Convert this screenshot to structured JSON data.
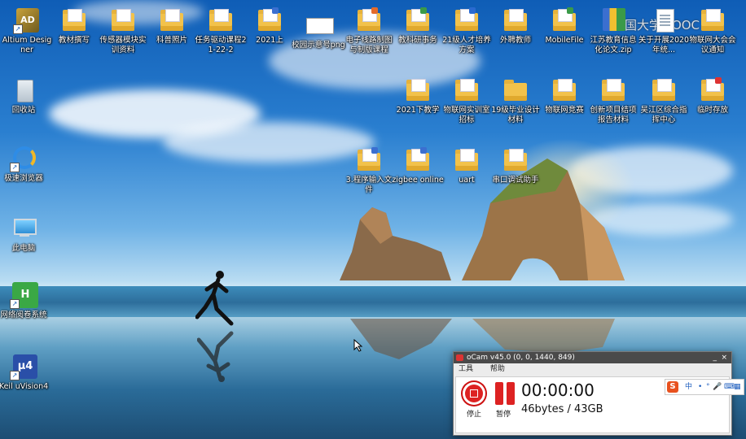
{
  "desktop": {
    "icons": [
      {
        "label": "Altium Designer",
        "type": "app-altium"
      },
      {
        "label": "回收站",
        "type": "recycle-bin"
      },
      {
        "label": "极速浏览器",
        "type": "browser"
      },
      {
        "label": "此电脑",
        "type": "this-pc"
      },
      {
        "label": "网络阅卷系统",
        "type": "exam-app"
      },
      {
        "label": "Keil uVision4",
        "type": "app-keil"
      },
      {
        "label": "教材撰写",
        "type": "folder"
      },
      {
        "label": "传感器模块实训资料",
        "type": "folder"
      },
      {
        "label": "科普照片",
        "type": "folder"
      },
      {
        "label": "任务驱动课程21-22-2",
        "type": "folder"
      },
      {
        "label": "2021上",
        "type": "folder"
      },
      {
        "label": "校园示意号png",
        "type": "image-file"
      },
      {
        "label": "电子线路制图与制版课程",
        "type": "folder"
      },
      {
        "label": "教科研事务",
        "type": "folder"
      },
      {
        "label": "21级人才培养方案",
        "type": "folder"
      },
      {
        "label": "外聘教师",
        "type": "folder"
      },
      {
        "label": "MobileFile",
        "type": "folder"
      },
      {
        "label": "江苏教育信息化论文.zip",
        "type": "zip"
      },
      {
        "label": "关于开展2020年统...",
        "type": "doc"
      },
      {
        "label": "物联网大会会议通知",
        "type": "folder"
      },
      {
        "label": "2021下教学",
        "type": "folder"
      },
      {
        "label": "物联网实训室招标",
        "type": "folder"
      },
      {
        "label": "19级毕业设计材料",
        "type": "folder"
      },
      {
        "label": "物联网竞赛",
        "type": "folder"
      },
      {
        "label": "创新项目结项报告材料",
        "type": "folder"
      },
      {
        "label": "吴江区综合指挥中心",
        "type": "folder"
      },
      {
        "label": "临时存放",
        "type": "folder-pdf"
      },
      {
        "label": "3.程序输入文件",
        "type": "folder"
      },
      {
        "label": "zigbee online",
        "type": "folder"
      },
      {
        "label": "uart",
        "type": "folder"
      },
      {
        "label": "串口调试助手",
        "type": "folder"
      }
    ],
    "watermark": "中国大学MOOC"
  },
  "ocam": {
    "title": "oCam v45.0 (0, 0, 1440, 849)",
    "menu": [
      "工具",
      "帮助"
    ],
    "stop_label": "停止",
    "pause_label": "暂停",
    "timer": "00:00:00",
    "size": "46bytes / 43GB",
    "minimize": "_",
    "close": "×"
  },
  "ime": {
    "logo": "S",
    "lang": "中",
    "items": [
      "•",
      "°",
      "🎤",
      "⌨",
      "▦"
    ]
  },
  "colors": {
    "folder": "#f2c24b",
    "record_red": "#dd2222",
    "ocam_title_bg": "#4a4a4a"
  }
}
